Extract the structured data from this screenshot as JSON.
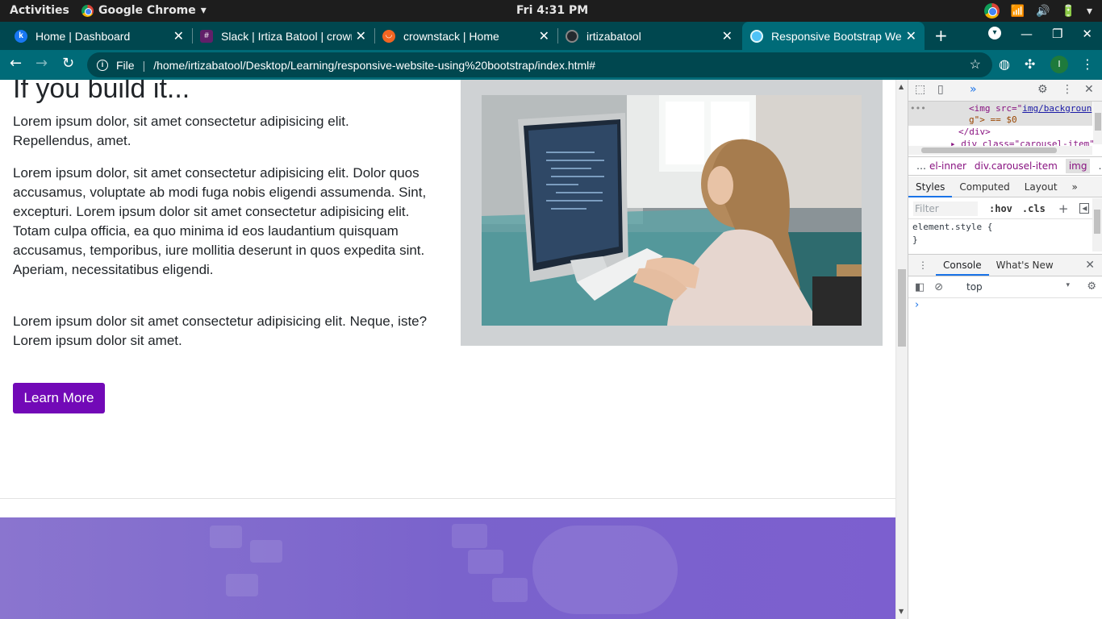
{
  "system_bar": {
    "activities": "Activities",
    "app_name": "Google Chrome",
    "app_menu_caret": "▾",
    "clock": "Fri  4:31 PM"
  },
  "tabs": [
    {
      "title": "Home | Dashboard",
      "favicon_color": "#1877f2",
      "favicon_letter": "k"
    },
    {
      "title": "Slack | Irtiza Batool | crownstack",
      "favicon_color": "#611f69",
      "favicon_letter": "#"
    },
    {
      "title": "crownstack | Home",
      "favicon_color": "#f26522",
      "favicon_letter": "◡"
    },
    {
      "title": "irtizabatool",
      "favicon_color": "#24292e",
      "favicon_letter": "●"
    },
    {
      "title": "Responsive Bootstrap Website",
      "favicon_color": "#4fc3f7",
      "favicon_letter": "◍"
    }
  ],
  "toolbar": {
    "scheme": "File",
    "url": "/home/irtizabatool/Desktop/Learning/responsive-website-using%20bootstrap/index.html#",
    "avatar_letter": "I"
  },
  "page": {
    "heading": "If you build it...",
    "paragraphs": [
      "Lorem ipsum dolor, sit amet consectetur adipisicing elit. Repellendus, amet.",
      "Lorem ipsum dolor, sit amet consectetur adipisicing elit. Dolor quos accusamus, voluptate ab modi fuga nobis eligendi assumenda. Sint, excepturi. Lorem ipsum dolor sit amet consectetur adipisicing elit. Totam culpa officia, ea quo minima id eos laudantium quisquam accusamus, temporibus, iure mollitia deserunt in quos expedita sint. Aperiam, necessitatibus eligendi.",
      "Lorem ipsum dolor sit amet consectetur adipisicing elit. Neque, iste? Lorem ipsum dolor sit amet."
    ],
    "learn_more_label": "Learn More",
    "accent_color": "#7209b7"
  },
  "devtools": {
    "elements": {
      "line1_tag": "<img src=\"",
      "line1_link": "img/backgroun",
      "line2": "g\"> == $0",
      "line3": "</div>",
      "line4": "▸ div class=\"carousel-item\""
    },
    "breadcrumbs": [
      "…",
      "el-inner",
      "div.carousel-item",
      "img",
      "…"
    ],
    "tabs": [
      "Styles",
      "Computed",
      "Layout",
      "»"
    ],
    "filter_placeholder": "Filter",
    "hov_label": ":hov",
    "cls_label": ".cls",
    "element_style_open": "element.style {",
    "element_style_close": "}",
    "drawer_tabs": [
      "Console",
      "What's New"
    ],
    "context": "top",
    "prompt": "›"
  }
}
